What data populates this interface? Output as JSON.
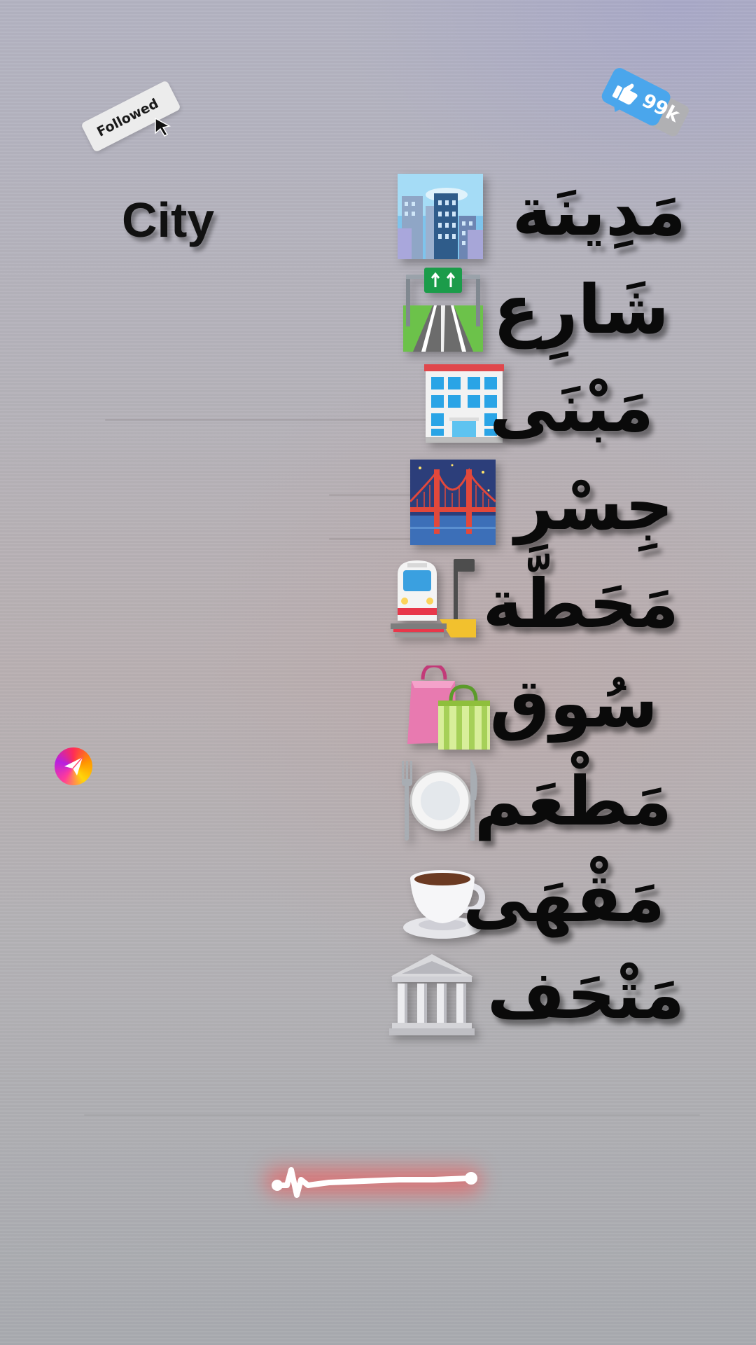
{
  "followed_tag": {
    "label": "Followed"
  },
  "like_badge": {
    "count": "99k",
    "color": "#4aa6ec"
  },
  "english_word": "City",
  "vocab": [
    {
      "arabic": "مَدِينَة",
      "icon": "cityscape-icon"
    },
    {
      "arabic": "شَارِع",
      "icon": "motorway-icon"
    },
    {
      "arabic": "مَبْنَى",
      "icon": "office-building-icon"
    },
    {
      "arabic": "جِسْر",
      "icon": "bridge-at-night-icon"
    },
    {
      "arabic": "مَحَطَّة",
      "icon": "train-station-icon"
    },
    {
      "arabic": "سُوق",
      "icon": "shopping-bags-icon"
    },
    {
      "arabic": "مَطْعَم",
      "icon": "fork-knife-plate-icon"
    },
    {
      "arabic": "مَقْهَى",
      "icon": "coffee-cup-icon"
    },
    {
      "arabic": "مَتْحَف",
      "icon": "classical-building-icon"
    }
  ],
  "share_button": {
    "icon": "paper-plane-icon"
  },
  "audio_wave": {
    "icon": "audio-waveform-icon",
    "color": "#ff4646"
  }
}
